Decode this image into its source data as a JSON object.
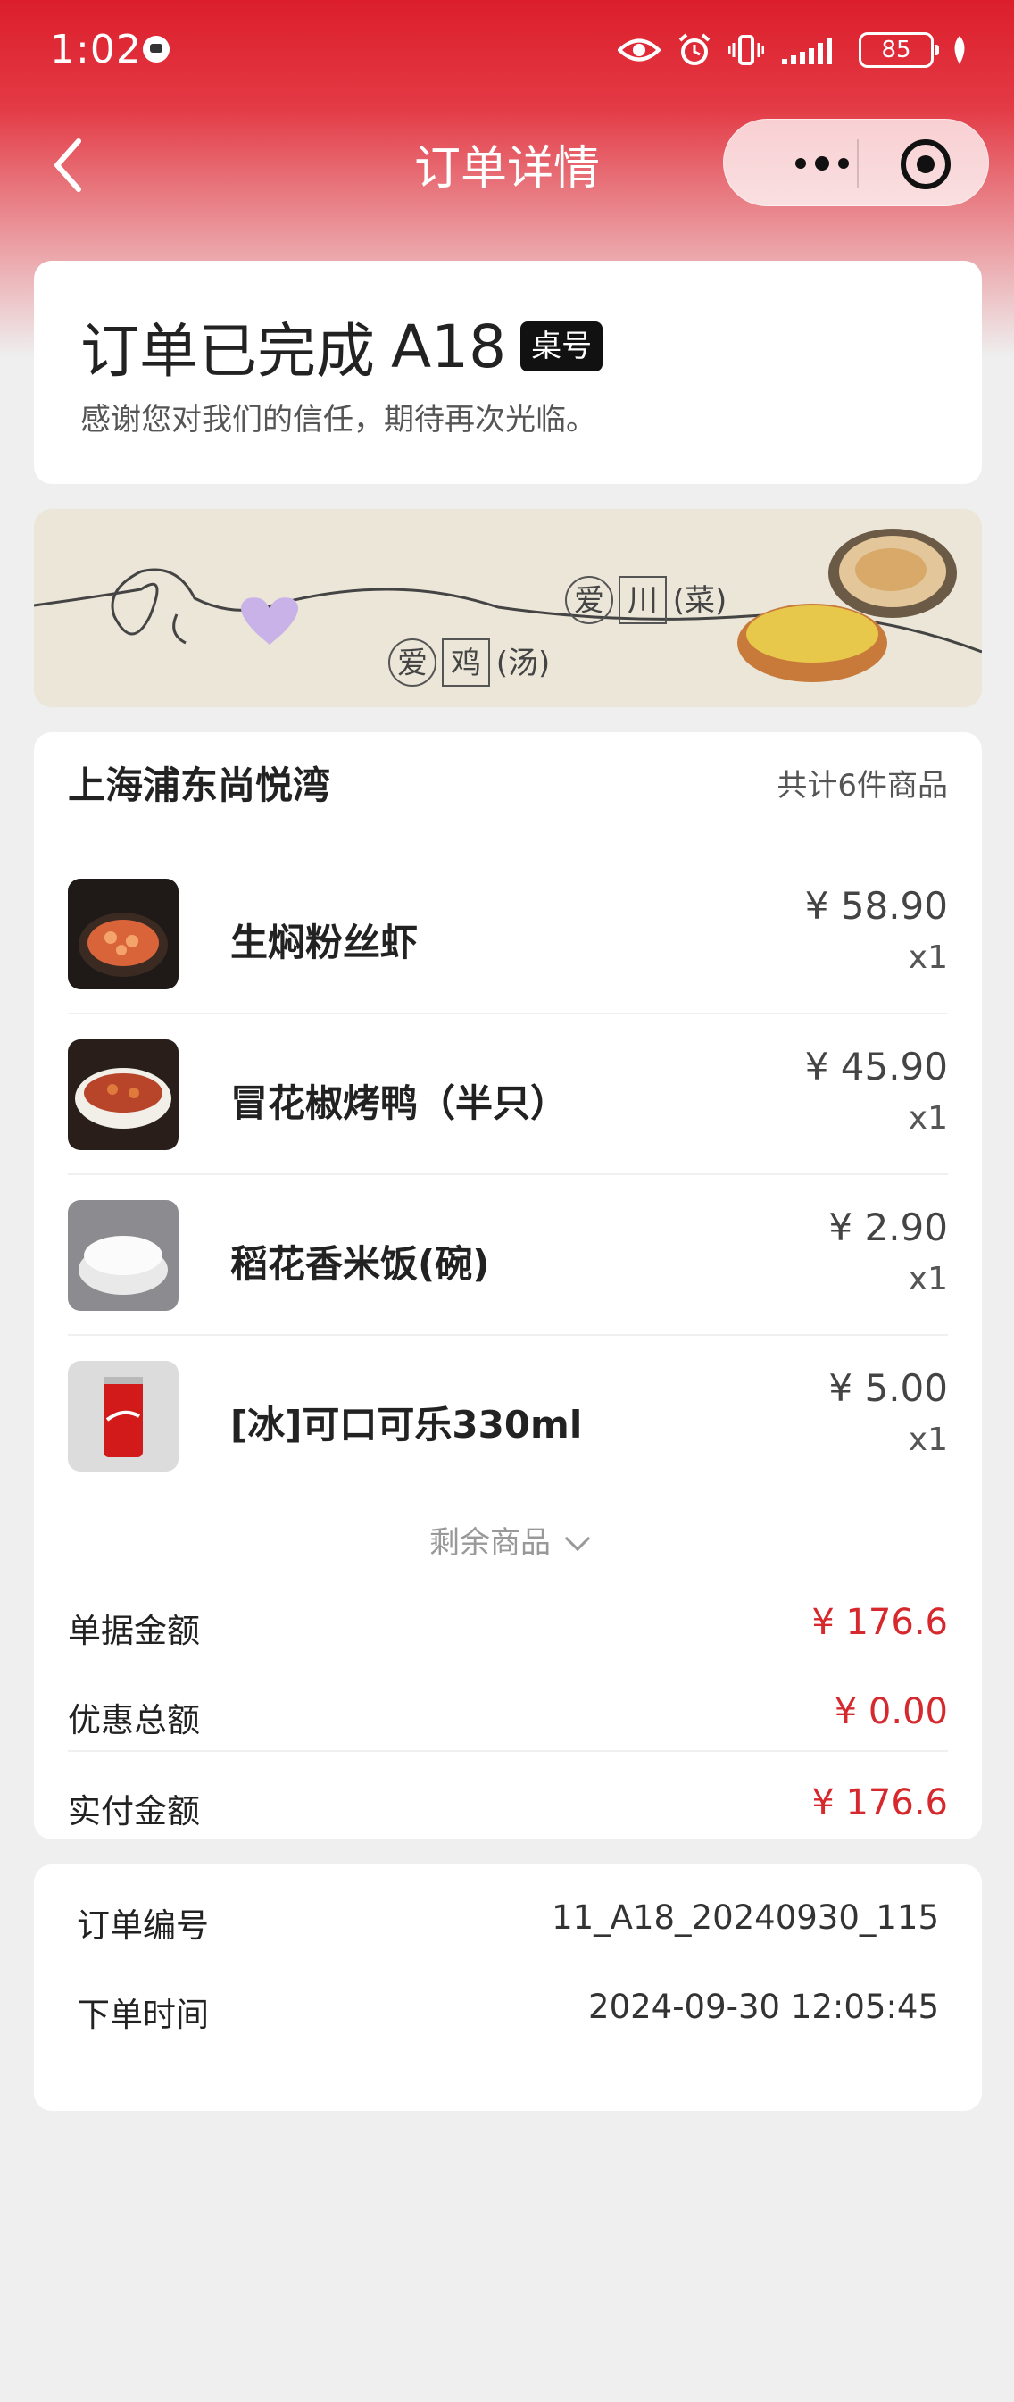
{
  "status_bar": {
    "time": "1:02",
    "battery": "85"
  },
  "nav": {
    "title": "订单详情"
  },
  "order_status": {
    "title": "订单已完成",
    "table_number": "A18",
    "table_badge": "桌号",
    "thanks": "感谢您对我们的信任，期待再次光临。"
  },
  "banner": {
    "text1": [
      "爱",
      "川",
      "(菜)"
    ],
    "text2": [
      "爱",
      "鸡",
      "(汤)"
    ]
  },
  "store": {
    "name": "上海浦东尚悦湾",
    "count": "共计6件商品"
  },
  "items": [
    {
      "name": "生焖粉丝虾",
      "price": "¥ 58.90",
      "qty": "x1"
    },
    {
      "name": "冒花椒烤鸭（半只）",
      "price": "¥ 45.90",
      "qty": "x1"
    },
    {
      "name": "稻花香米饭(碗)",
      "price": "¥ 2.90",
      "qty": "x1"
    },
    {
      "name": "[冰]可口可乐330ml",
      "price": "¥ 5.00",
      "qty": "x1"
    }
  ],
  "more_items": "剩余商品",
  "summary": {
    "bill_label": "单据金额",
    "bill_value": "¥ 176.6",
    "discount_label": "优惠总额",
    "discount_value": "¥ 0.00",
    "paid_label": "实付金额",
    "paid_value": "¥ 176.6"
  },
  "order_info": {
    "number_label": "订单编号",
    "number_value": "11_A18_20240930_115",
    "time_label": "下单时间",
    "time_value": "2024-09-30 12:05:45"
  },
  "colors": {
    "header_red": "#dc1e2b",
    "price_red": "#d6292e",
    "background": "#efefef"
  }
}
